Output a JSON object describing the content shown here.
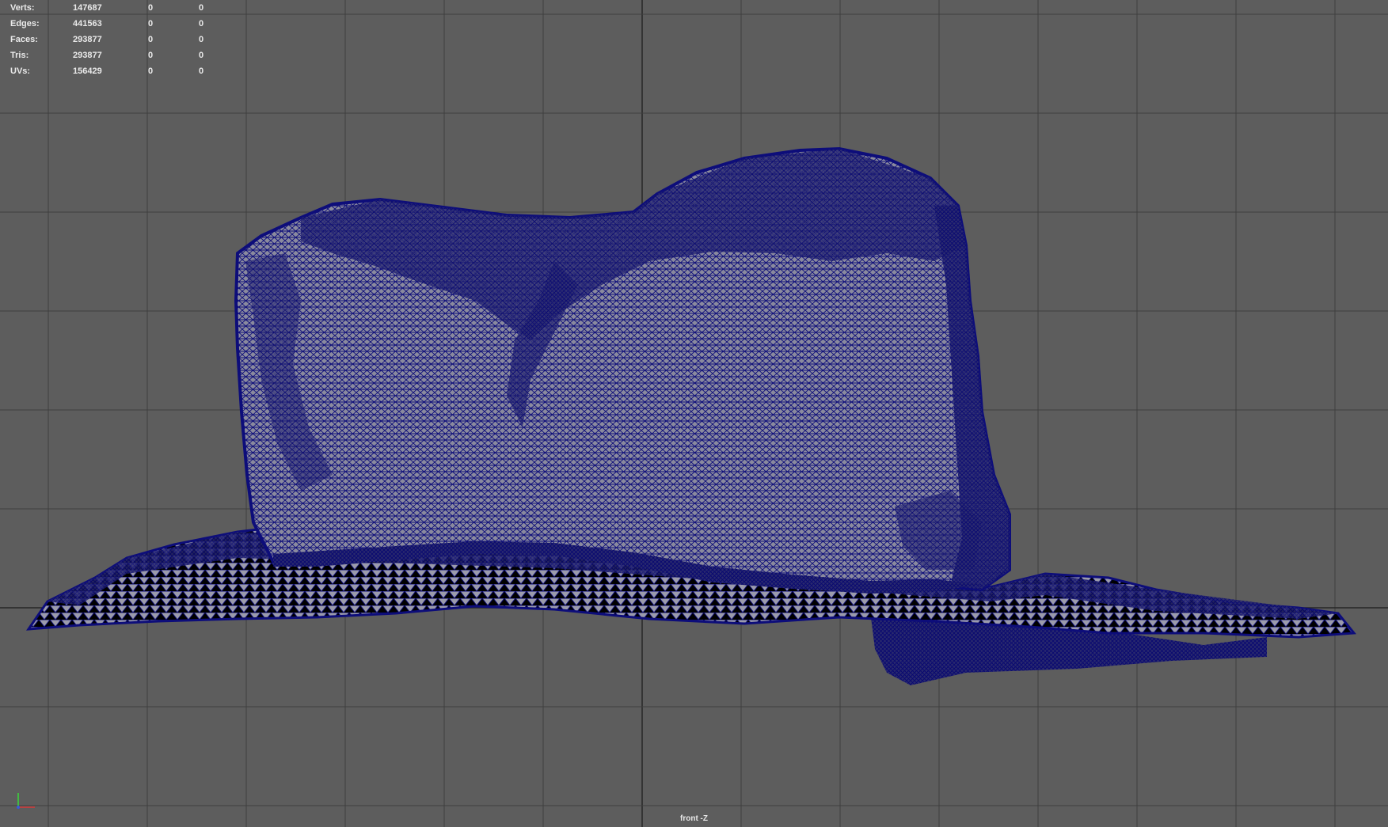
{
  "hud": {
    "rows": [
      {
        "label": "Verts:",
        "value": "147687",
        "sel1": "0",
        "sel2": "0"
      },
      {
        "label": "Edges:",
        "value": "441563",
        "sel1": "0",
        "sel2": "0"
      },
      {
        "label": "Faces:",
        "value": "293877",
        "sel1": "0",
        "sel2": "0"
      },
      {
        "label": "Tris:",
        "value": "293877",
        "sel1": "0",
        "sel2": "0"
      },
      {
        "label": "UVs:",
        "value": "156429",
        "sel1": "0",
        "sel2": "0"
      }
    ]
  },
  "viewport": {
    "camera_label": "front -Z",
    "colors": {
      "background": "#5d5d5d",
      "grid_line": "#3f3f3f",
      "grid_axis": "#262626",
      "wireframe": "#0d0d7a",
      "mesh_fill": "#8a8a9e",
      "mesh_shadow": "#1a1a55"
    }
  },
  "axis_gizmo": {
    "x_color": "#d83a3a",
    "y_color": "#3ad83a",
    "z_color": "#3a5ad8"
  }
}
